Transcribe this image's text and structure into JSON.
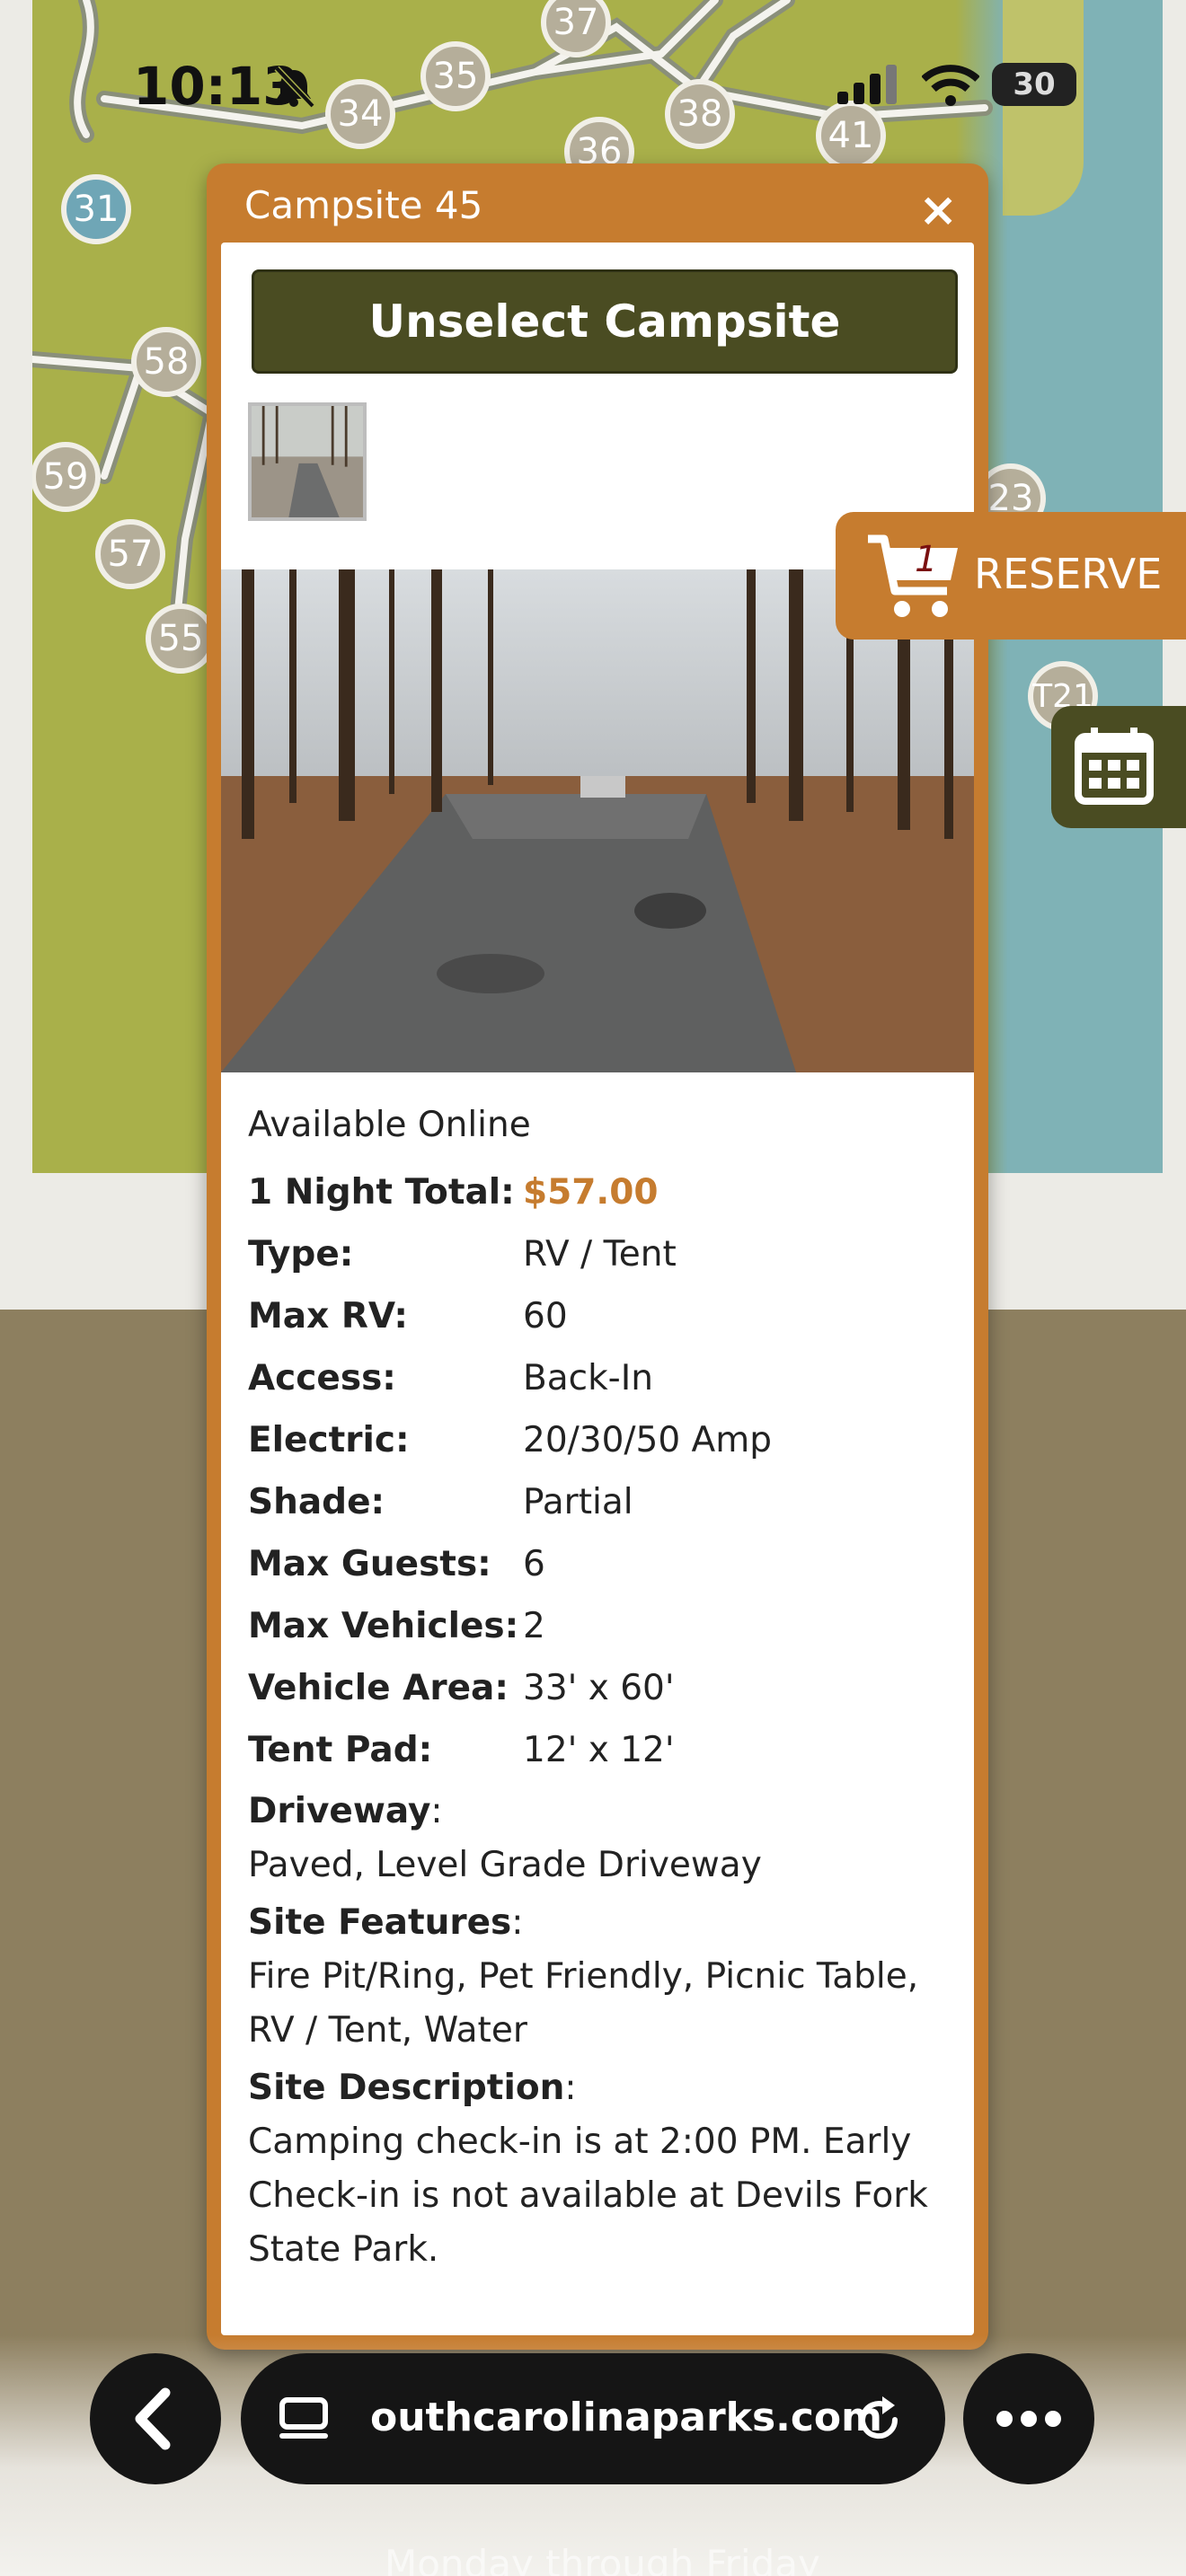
{
  "status_bar": {
    "time": "10:13",
    "battery": "30"
  },
  "map": {
    "site_labels": [
      "31",
      "34",
      "35",
      "36",
      "37",
      "38",
      "41",
      "55",
      "57",
      "58",
      "59",
      "23",
      "T21"
    ]
  },
  "popup": {
    "title": "Campsite 45",
    "close_symbol": "×",
    "unselect_label": "Unselect Campsite",
    "availability": "Available Online",
    "details": [
      {
        "label": "1 Night Total:",
        "value": "$57.00"
      },
      {
        "label": "Type:",
        "value": "RV / Tent"
      },
      {
        "label": "Max RV:",
        "value": "60"
      },
      {
        "label": "Access:",
        "value": "Back-In"
      },
      {
        "label": "Electric:",
        "value": "20/30/50 Amp"
      },
      {
        "label": "Shade:",
        "value": "Partial"
      },
      {
        "label": "Max Guests:",
        "value": "6"
      },
      {
        "label": "Max Vehicles:",
        "value": "2"
      },
      {
        "label": "Vehicle Area:",
        "value": "33' x 60'"
      },
      {
        "label": "Tent Pad:",
        "value": "12' x 12'"
      }
    ],
    "driveway": {
      "label": "Driveway",
      "value": "Paved, Level Grade Driveway"
    },
    "site_features": {
      "label": "Site Features",
      "value": "Fire Pit/Ring, Pet Friendly, Picnic Table, RV / Tent, Water"
    },
    "site_description": {
      "label": "Site Description",
      "value": "Camping check-in is at 2:00 PM. Early Check-in is not available at Devils Fork State Park."
    }
  },
  "reserve": {
    "label": "RESERVE",
    "cart_count": "1"
  },
  "browser": {
    "url": "outhcarolinaparks.com"
  },
  "footer_text": "Monday through Friday",
  "colors": {
    "accent": "#c67c2f",
    "dark_olive": "#4a4c22",
    "map_green": "#a9b04a",
    "lake": "#7fb2b6"
  }
}
